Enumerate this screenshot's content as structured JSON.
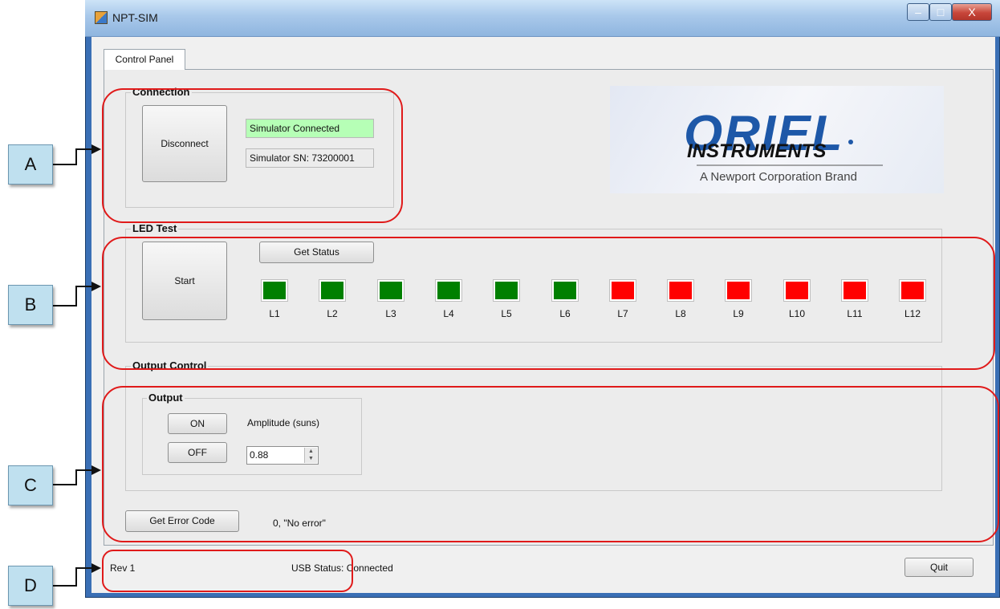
{
  "window": {
    "title": "NPT-SIM",
    "min_symbol": "‒",
    "max_symbol": "□",
    "close_symbol": "X"
  },
  "tabs": [
    {
      "label": "Control Panel",
      "active": true
    }
  ],
  "connection": {
    "group_label": "Connection",
    "disconnect_label": "Disconnect",
    "status_text": "Simulator Connected",
    "serial_text": "Simulator SN: 73200001",
    "status_color": "#b6ffb6"
  },
  "logo": {
    "brand": "ORIEL",
    "subbrand": "INSTRUMENTS",
    "tagline": "A Newport Corporation Brand"
  },
  "led_test": {
    "group_label": "LED Test",
    "start_label": "Start",
    "get_status_label": "Get Status",
    "leds": [
      {
        "label": "L1",
        "status": "green"
      },
      {
        "label": "L2",
        "status": "green"
      },
      {
        "label": "L3",
        "status": "green"
      },
      {
        "label": "L4",
        "status": "green"
      },
      {
        "label": "L5",
        "status": "green"
      },
      {
        "label": "L6",
        "status": "green"
      },
      {
        "label": "L7",
        "status": "red"
      },
      {
        "label": "L8",
        "status": "red"
      },
      {
        "label": "L9",
        "status": "red"
      },
      {
        "label": "L10",
        "status": "red"
      },
      {
        "label": "L11",
        "status": "red"
      },
      {
        "label": "L12",
        "status": "red"
      }
    ],
    "colors": {
      "green": "#008000",
      "red": "#ff0000"
    }
  },
  "output_control": {
    "group_label": "Output Control",
    "output_group_label": "Output",
    "on_label": "ON",
    "off_label": "OFF",
    "amplitude_label": "Amplitude (suns)",
    "amplitude_value": "0.88"
  },
  "error": {
    "button_label": "Get Error Code",
    "text": "0, \"No error\""
  },
  "statusbar": {
    "rev": "Rev 1",
    "usb_status": "USB Status: Connected",
    "quit_label": "Quit"
  },
  "annotations": {
    "callouts": [
      "A",
      "B",
      "C",
      "D"
    ],
    "highlight_color": "#e01a1a"
  }
}
